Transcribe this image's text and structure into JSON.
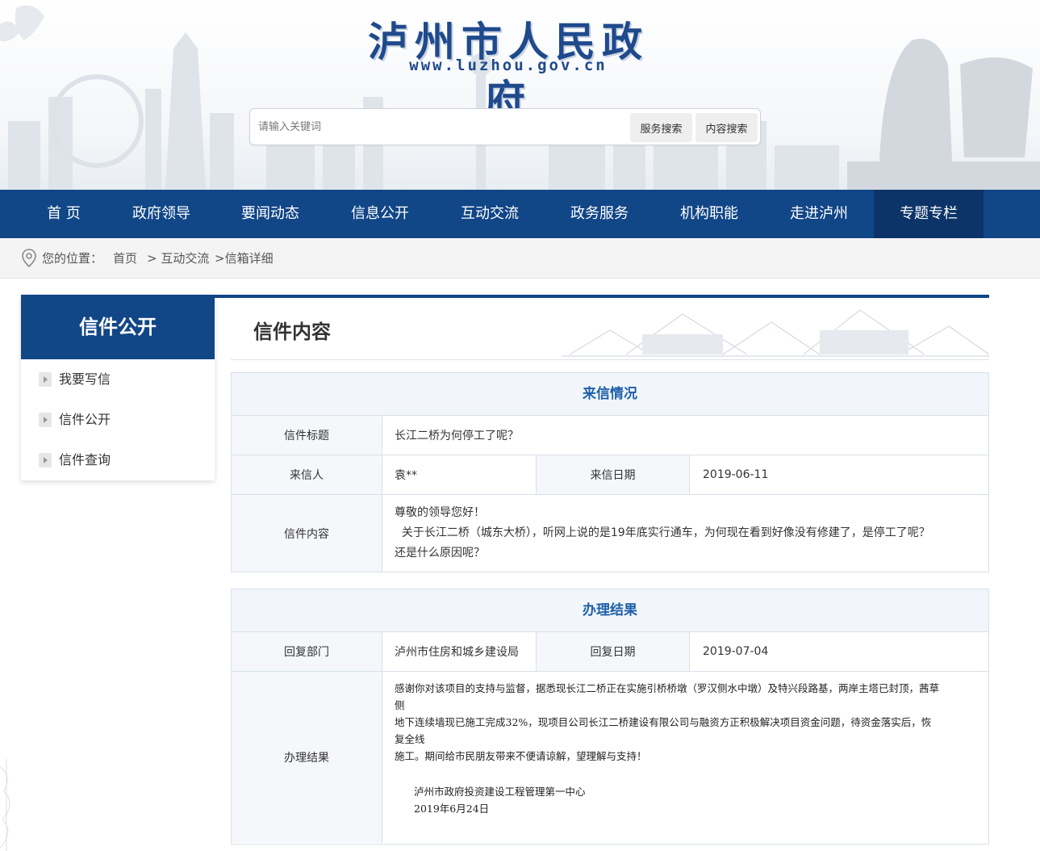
{
  "header": {
    "site_title": "泸州市人民政府",
    "site_url": "www.luzhou.gov.cn",
    "search": {
      "placeholder": "请输入关键词",
      "service_button": "服务搜索",
      "content_button": "内容搜索"
    }
  },
  "nav": {
    "items": [
      "首 页",
      "政府领导",
      "要闻动态",
      "信息公开",
      "互动交流",
      "政务服务",
      "机构职能",
      "走进泸州",
      "专题专栏"
    ],
    "active": "专题专栏"
  },
  "breadcrumb": {
    "prefix": "您的位置：",
    "home": "首页",
    "section": "> 互动交流",
    "current": ">信箱详细"
  },
  "sidebar": {
    "title": "信件公开",
    "items": [
      "我要写信",
      "信件公开",
      "信件查询"
    ]
  },
  "main": {
    "title": "信件内容",
    "letter": {
      "section_title": "来信情况",
      "subject_label": "信件标题",
      "subject": "长江二桥为何停工了呢？",
      "sender_label": "来信人",
      "sender": "袁**",
      "date_label": "来信日期",
      "date": "2019-06-11",
      "content_label": "信件内容",
      "content_lines": [
        "尊敬的领导您好！",
        "  关于长江二桥（城东大桥），听网上说的是19年底实行通车，为何现在看到好像没有修建了，是停工了呢？",
        "还是什么原因呢？"
      ]
    },
    "reply": {
      "section_title": "办理结果",
      "dept_label": "回复部门",
      "dept": "泸州市住房和城乡建设局",
      "date_label": "回复日期",
      "date": "2019-07-04",
      "result_label": "办理结果",
      "result_lines": [
        "感谢你对该项目的支持与监督，据悉现长江二桥正在实施引桥桥墩（罗汉侧水中墩）及特兴段路基，两岸主塔已封顶，茜草侧",
        "地下连续墙现已施工完成32%，现项目公司长江二桥建设有限公司与融资方正积极解决项目资金问题，待资金落实后，恢复全线",
        "施工。期间给市民朋友带来不便请谅解，望理解与支持！"
      ],
      "signature": "泸州市政府投资建设工程管理第一中心",
      "signature_date": "2019年6月24日"
    }
  },
  "colors": {
    "nav_blue": "#114687",
    "nav_active": "#0c3468",
    "section_title": "#1f5fa8",
    "title_blue": "#1f4a8c"
  }
}
